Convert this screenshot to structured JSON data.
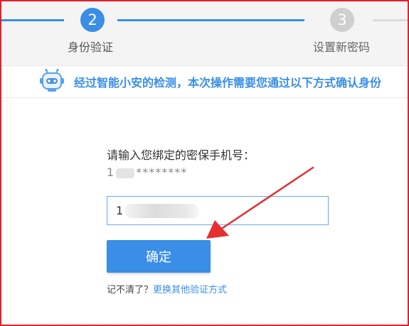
{
  "steps": [
    {
      "number": "2",
      "label": "身份验证",
      "state": "active"
    },
    {
      "number": "3",
      "label": "设置新密码",
      "state": "inactive"
    }
  ],
  "notice": {
    "icon": "robot-icon",
    "text": "经过智能小安的检测，本次操作需要您通过以下方式确认身份"
  },
  "form": {
    "prompt": "请输入您绑定的密保手机号：",
    "masked_prefix": "1",
    "masked_stars": "********",
    "input_value": "1",
    "confirm_label": "确定",
    "forgot_text": "记不清了？",
    "alt_link": "更换其他验证方式"
  },
  "colors": {
    "accent": "#3a8ee6",
    "frame": "#e0202a",
    "arrow": "#e53030"
  }
}
